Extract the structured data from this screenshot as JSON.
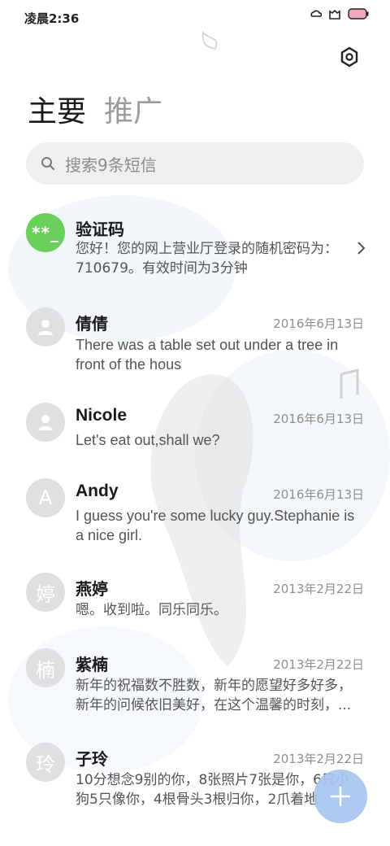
{
  "status_bar": {
    "time": "凌晨2:36"
  },
  "header": {
    "tab_main": "主要",
    "tab_promo": "推广"
  },
  "search": {
    "placeholder": "搜索9条短信"
  },
  "messages": [
    {
      "avatar": "**_",
      "sender": "验证码",
      "date": "",
      "body": "您好！您的网上营业厅登录的随机密码为：710679。有效时间为3分钟"
    },
    {
      "avatar": "",
      "sender": "倩倩",
      "date": "2016年6月13日",
      "body": "There was a table set out under a tree in front of the hous"
    },
    {
      "avatar": "",
      "sender": "Nicole",
      "date": "2016年6月13日",
      "body": "Let's eat out,shall we?"
    },
    {
      "avatar": "A",
      "sender": "Andy",
      "date": "2016年6月13日",
      "body": "I guess you're some lucky guy.Stephanie is a nice girl."
    },
    {
      "avatar": "婷",
      "sender": "燕婷",
      "date": "2013年2月22日",
      "body": "嗯。收到啦。同乐同乐。"
    },
    {
      "avatar": "楠",
      "sender": "紫楠",
      "date": "2013年2月22日",
      "body": "新年的祝福数不胜数，新年的愿望好多好多，新年的问候依旧美好，在这个温馨的时刻，..."
    },
    {
      "avatar": "玲",
      "sender": "子玲",
      "date": "2013年2月22日",
      "body": "10分想念9别的你，8张照片7张是你，6只小狗5只像你，4根骨头3根归你，2爪着地"
    }
  ],
  "colors": {
    "accent_green": "#6ad05a",
    "fab_blue": "#a6c4ee"
  },
  "icons": [
    "settings-icon",
    "search-icon",
    "chevron-right-icon",
    "person-icon",
    "plus-icon"
  ]
}
